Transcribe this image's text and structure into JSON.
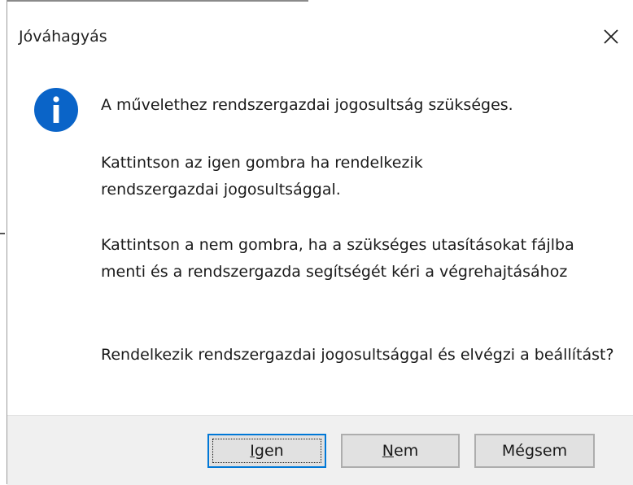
{
  "dialog": {
    "title": "Jóváhagyás",
    "icon": "info-icon",
    "messages": [
      "A művelethez rendszergazdai jogosultság szükséges.",
      "Kattintson az igen gombra ha rendelkezik rendszergazdai jogosultsággal.",
      "Kattintson a nem gombra, ha a szükséges utasításokat fájlba menti és a rendszergazda segítségét kéri a végrehajtásához",
      "Rendelkezik rendszergazdai jogosultsággal és elvégzi a beállítást?"
    ]
  },
  "buttons": {
    "yes": {
      "mnemonic": "I",
      "rest": "gen"
    },
    "no": {
      "mnemonic": "N",
      "rest": "em"
    },
    "cancel": {
      "label": "Mégsem"
    }
  },
  "colors": {
    "accent": "#0078d7",
    "icon_blue": "#0a64c8",
    "footer_bg": "#f0f0f0",
    "button_bg": "#e1e1e1"
  }
}
